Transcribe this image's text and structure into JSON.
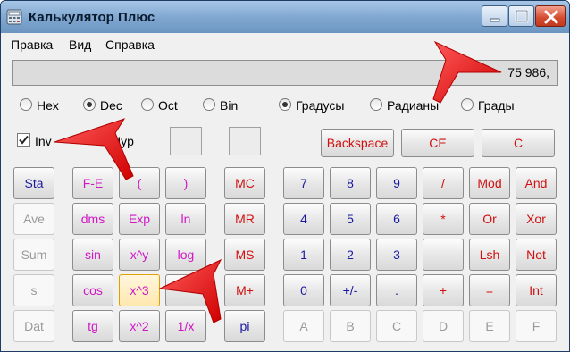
{
  "window": {
    "title": "Калькулятор Плюс",
    "controls": [
      "minimize",
      "maximize",
      "close"
    ]
  },
  "menu": {
    "items": [
      "Правка",
      "Вид",
      "Справка"
    ]
  },
  "display": {
    "value": "75 986,"
  },
  "number_system": {
    "options": [
      "Hex",
      "Dec",
      "Oct",
      "Bin"
    ],
    "selected": "Dec"
  },
  "angle_units": {
    "options": [
      "Градусы",
      "Радианы",
      "Грады"
    ],
    "selected": "Градусы"
  },
  "checkboxes": {
    "inv": {
      "label": "Inv",
      "checked": true
    },
    "hyp": {
      "label": "Hyp",
      "checked": false
    }
  },
  "top_buttons": [
    "Backspace",
    "CE",
    "C"
  ],
  "stat_buttons": [
    "Sta",
    "Ave",
    "Sum",
    "s",
    "Dat"
  ],
  "sci_buttons": [
    [
      "F-E",
      "(",
      ")"
    ],
    [
      "dms",
      "Exp",
      "ln"
    ],
    [
      "sin",
      "x^y",
      "log"
    ],
    [
      "cos",
      "x^3",
      ""
    ],
    [
      "tg",
      "x^2",
      "1/x"
    ]
  ],
  "memory_buttons": [
    "MC",
    "MR",
    "MS",
    "M+",
    "pi"
  ],
  "keypad": [
    [
      "7",
      "8",
      "9",
      "/",
      "Mod",
      "And"
    ],
    [
      "4",
      "5",
      "6",
      "*",
      "Or",
      "Xor"
    ],
    [
      "1",
      "2",
      "3",
      "–",
      "Lsh",
      "Not"
    ],
    [
      "0",
      "+/-",
      ".",
      "+",
      "=",
      "Int"
    ],
    [
      "A",
      "B",
      "C",
      "D",
      "E",
      "F"
    ]
  ],
  "colors": {
    "titlebar": "#7ea6cf",
    "digit_text": "#1a1aa0",
    "operator_text": "#d01010",
    "function_text": "#d017c4",
    "disabled_text": "#9a9a9a",
    "annotation_arrow": "#ff0000"
  }
}
